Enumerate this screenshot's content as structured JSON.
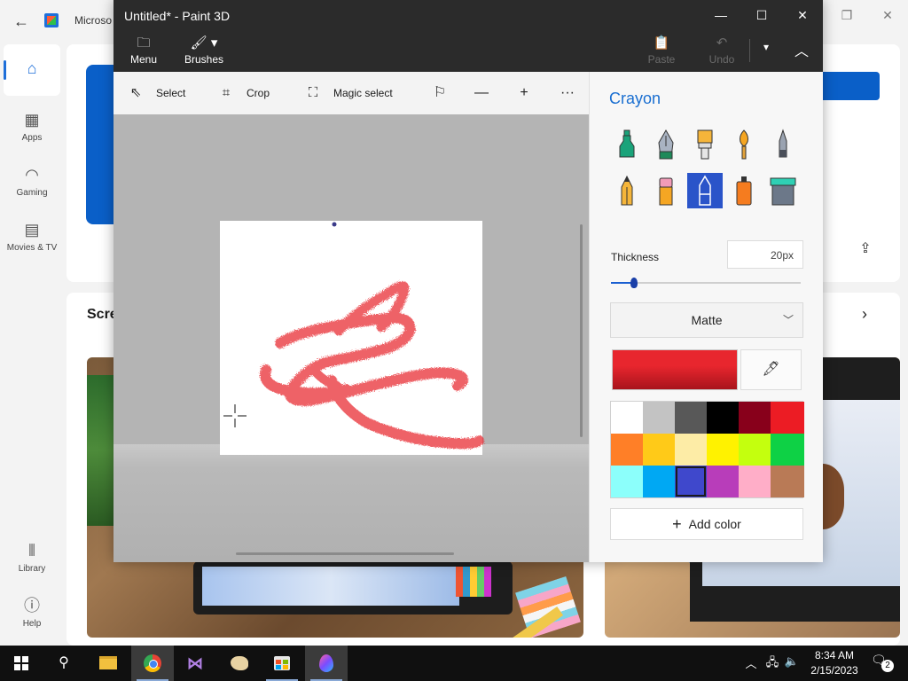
{
  "store": {
    "title": "Microso",
    "nav": [
      {
        "label": "",
        "icon": "home-icon"
      },
      {
        "label": "Apps",
        "icon": "apps-icon"
      },
      {
        "label": "Gaming",
        "icon": "gamepad-icon"
      },
      {
        "label": "Movies & TV",
        "icon": "clapperboard-icon"
      },
      {
        "label": "Library",
        "icon": "library-icon"
      },
      {
        "label": "Help",
        "icon": "help-icon"
      }
    ],
    "section_title": "Scre"
  },
  "paint": {
    "title": "Untitled* - Paint 3D",
    "ribbon": {
      "menu_label": "Menu",
      "brushes_label": "Brushes",
      "paste_label": "Paste",
      "undo_label": "Undo"
    },
    "toolbar": {
      "select_label": "Select",
      "crop_label": "Crop",
      "magic_select_label": "Magic select"
    },
    "panel": {
      "title": "Crayon",
      "brushes": [
        {
          "name": "marker",
          "selected": false
        },
        {
          "name": "calligraphy-pen",
          "selected": false
        },
        {
          "name": "oil-brush",
          "selected": false
        },
        {
          "name": "watercolor",
          "selected": false
        },
        {
          "name": "pixel-pen",
          "selected": false
        },
        {
          "name": "pencil",
          "selected": false
        },
        {
          "name": "eraser",
          "selected": false
        },
        {
          "name": "crayon",
          "selected": true
        },
        {
          "name": "spray-can",
          "selected": false
        },
        {
          "name": "fill",
          "selected": false
        }
      ],
      "thickness_label": "Thickness",
      "thickness_value": "20px",
      "thickness_fraction": 0.12,
      "finish": "Matte",
      "current_color": "#e8262e",
      "palette": [
        "#ffffff",
        "#c3c3c3",
        "#585858",
        "#000000",
        "#88001b",
        "#ec1c24",
        "#ff7f27",
        "#ffca18",
        "#fdeca6",
        "#fff200",
        "#c4ff0e",
        "#0ed145",
        "#8cfffb",
        "#00a8f3",
        "#3f48cc",
        "#b83dba",
        "#ffaec8",
        "#b97a56"
      ],
      "selected_swatch": 14,
      "add_color_label": "Add color"
    }
  },
  "taskbar": {
    "time": "8:34 AM",
    "date": "2/15/2023",
    "notification_count": "2"
  }
}
